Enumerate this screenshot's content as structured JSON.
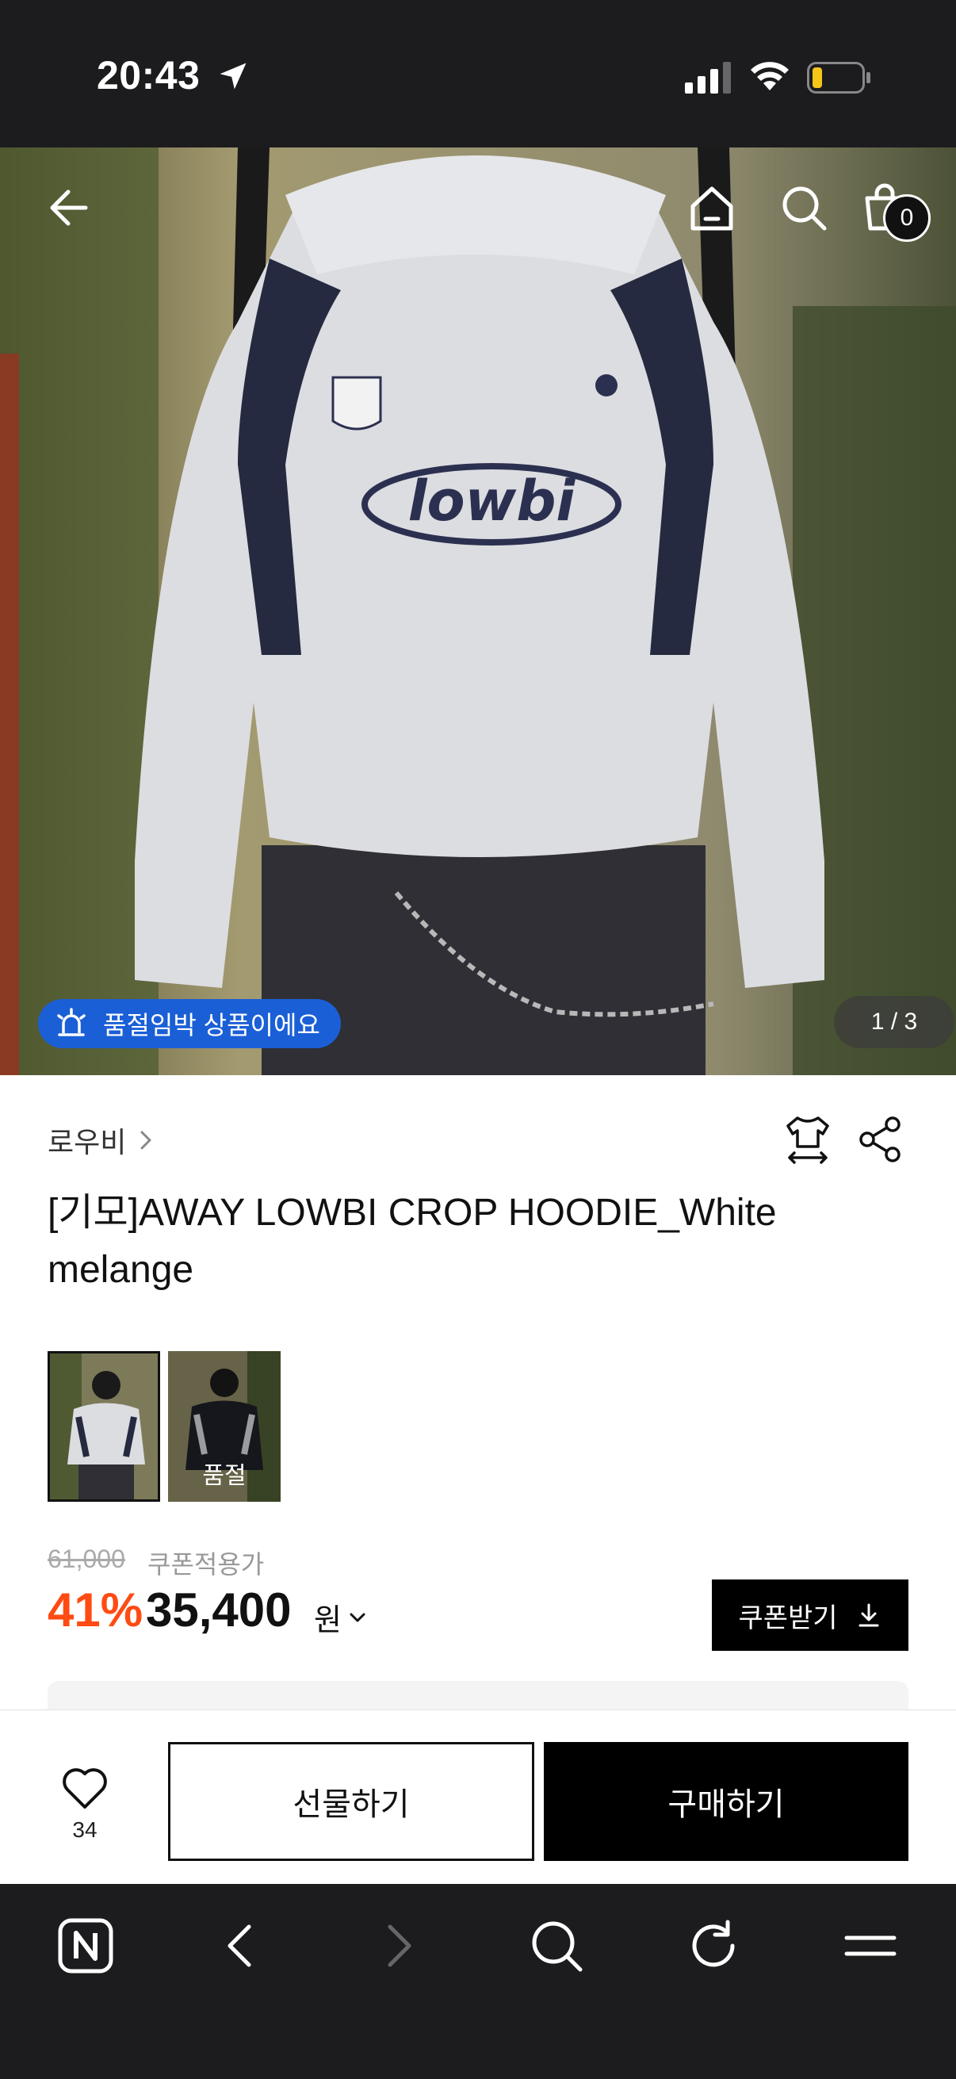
{
  "status_bar": {
    "time": "20:43",
    "icons": [
      "location-arrow-icon",
      "cellular-signal-icon",
      "wifi-icon",
      "battery-low-icon"
    ]
  },
  "hero": {
    "nav_icons": [
      "back-arrow-icon",
      "home-icon",
      "search-icon",
      "shopping-bag-icon"
    ],
    "cart_count": "0",
    "soldout_chip": "품절임박 상품이에요",
    "page_indicator": "1 / 3"
  },
  "product": {
    "brand": "로우비",
    "title": "[기모]AWAY LOWBI CROP HOODIE_White melange",
    "thumbnails": [
      {
        "label": "",
        "selected": true
      },
      {
        "label": "품절",
        "selected": false
      }
    ],
    "original_price": "61,000",
    "coupon_price_label": "쿠폰적용가",
    "discount": "41%",
    "price": "35,400",
    "currency": "원",
    "coupon_button": "쿠폰받기"
  },
  "action_bar": {
    "like_count": "34",
    "gift_button": "선물하기",
    "buy_button": "구매하기"
  },
  "browser_bar": {
    "icons": [
      "naver-home-icon",
      "back-chevron-icon",
      "forward-chevron-icon",
      "search-icon",
      "reload-icon",
      "menu-icon"
    ]
  },
  "colors": {
    "accent_discount": "#ff4b13",
    "chip_blue": "#1a5fd6",
    "dark_bar": "#1c1c1e"
  }
}
